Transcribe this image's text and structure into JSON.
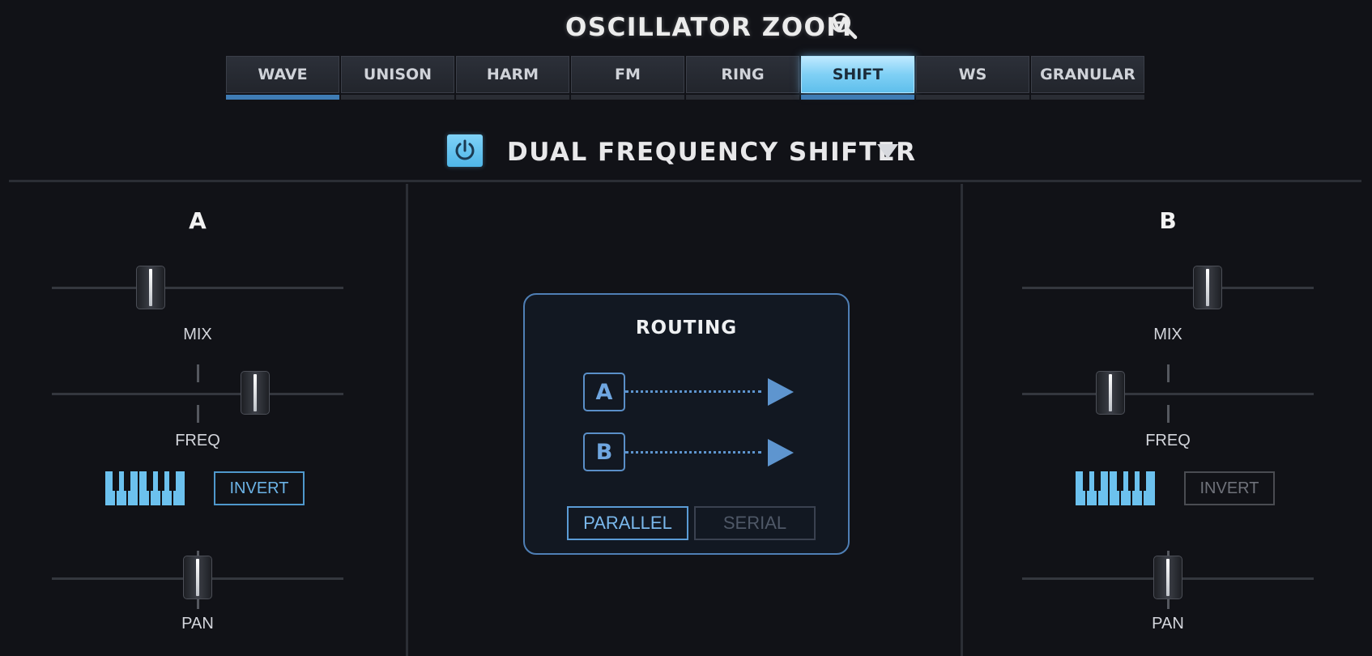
{
  "header": {
    "title": "OSCILLATOR ZOOM",
    "zoom_icon": "zoom-out-icon"
  },
  "tabs": [
    {
      "label": "WAVE",
      "active": false,
      "indicator": true
    },
    {
      "label": "UNISON",
      "active": false,
      "indicator": false
    },
    {
      "label": "HARM",
      "active": false,
      "indicator": false
    },
    {
      "label": "FM",
      "active": false,
      "indicator": false
    },
    {
      "label": "RING",
      "active": false,
      "indicator": false
    },
    {
      "label": "SHIFT",
      "active": true,
      "indicator": true
    },
    {
      "label": "WS",
      "active": false,
      "indicator": false
    },
    {
      "label": "GRANULAR",
      "active": false,
      "indicator": false
    }
  ],
  "effect": {
    "name": "DUAL FREQUENCY SHIFTER",
    "enabled": true,
    "power_icon": "power-icon",
    "dropdown_icon": "triangle-down-icon"
  },
  "channels": {
    "a": {
      "label": "A",
      "mix_label": "MIX",
      "mix_value": 0.32,
      "freq_label": "FREQ",
      "freq_value": 0.72,
      "pan_label": "PAN",
      "pan_value": 0.5,
      "invert_label": "INVERT",
      "invert_enabled": true,
      "keyboard_icon": "keyboard-icon"
    },
    "b": {
      "label": "B",
      "mix_label": "MIX",
      "mix_value": 0.65,
      "freq_label": "FREQ",
      "freq_value": 0.28,
      "pan_label": "PAN",
      "pan_value": 0.5,
      "invert_label": "INVERT",
      "invert_enabled": false,
      "keyboard_icon": "keyboard-icon"
    }
  },
  "routing": {
    "title": "ROUTING",
    "paths": [
      "A",
      "B"
    ],
    "parallel_label": "PARALLEL",
    "serial_label": "SERIAL",
    "mode": "PARALLEL"
  },
  "colors": {
    "accent": "#6fbfea",
    "routing": "#5e95cf",
    "background": "#111217"
  }
}
